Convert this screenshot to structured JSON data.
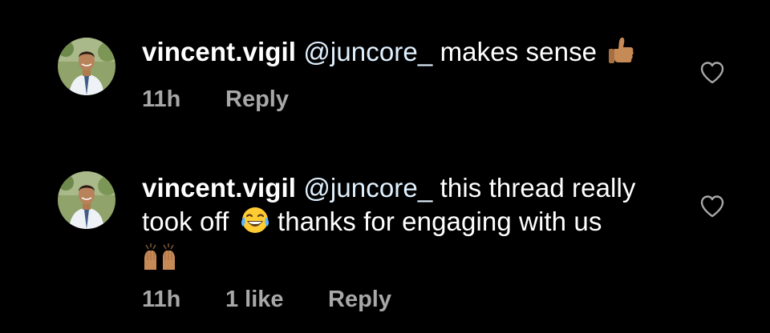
{
  "comments": [
    {
      "username": "vincent.vigil",
      "mention": "@juncore_",
      "text": "makes sense",
      "emoji": "thumbs-up-icon",
      "time": "11h",
      "reply": "Reply"
    },
    {
      "username": "vincent.vigil",
      "mention": "@juncore_",
      "text_line1": "this thread really",
      "text_line2a": "took off",
      "text_line2b": "thanks for engaging with us",
      "emoji_1": "tears-of-joy-icon",
      "emoji_2": "raising-hands-icon",
      "time": "11h",
      "likes": "1 like",
      "reply": "Reply"
    }
  ],
  "colors": {
    "background": "#000000",
    "text": "#ffffff",
    "mention": "#e0f1ff",
    "meta": "#a8a8a8",
    "skin_tone": "#c68a57"
  }
}
